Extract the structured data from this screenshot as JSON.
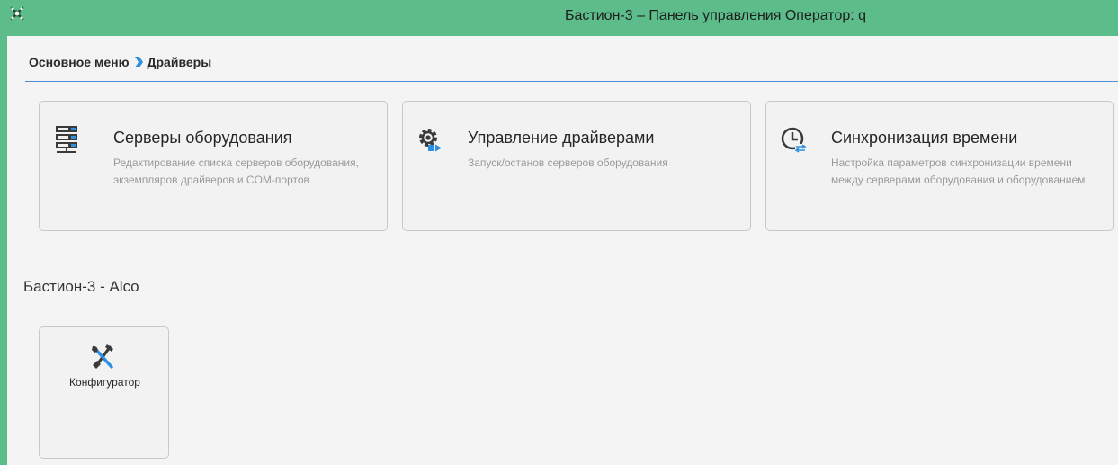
{
  "window": {
    "title": "Бастион-3 – Панель управления Оператор: q",
    "icon": "app-logo-icon"
  },
  "breadcrumb": {
    "root": "Основное меню",
    "separator_icon": "chevron-right-icon",
    "current": "Драйверы"
  },
  "cards": [
    {
      "icon": "server-rack-icon",
      "title": "Серверы оборудования",
      "description": "Редактирование списка серверов оборудования, экземпляров драйверов и COM-портов"
    },
    {
      "icon": "driver-gear-play-icon",
      "title": "Управление драйверами",
      "description": "Запуск/останов серверов оборудования"
    },
    {
      "icon": "clock-sync-icon",
      "title": "Синхронизация времени",
      "description": "Настройка параметров синхронизации времени между серверами оборудования и оборудованием"
    }
  ],
  "section": {
    "title": "Бастион-3 - Alco",
    "tiles": [
      {
        "icon": "tools-icon",
        "label": "Конфигуратор"
      }
    ]
  },
  "colors": {
    "titlebar": "#5cbd8b",
    "divider": "#4c8fd6",
    "accent_blue": "#2f8fe0"
  }
}
